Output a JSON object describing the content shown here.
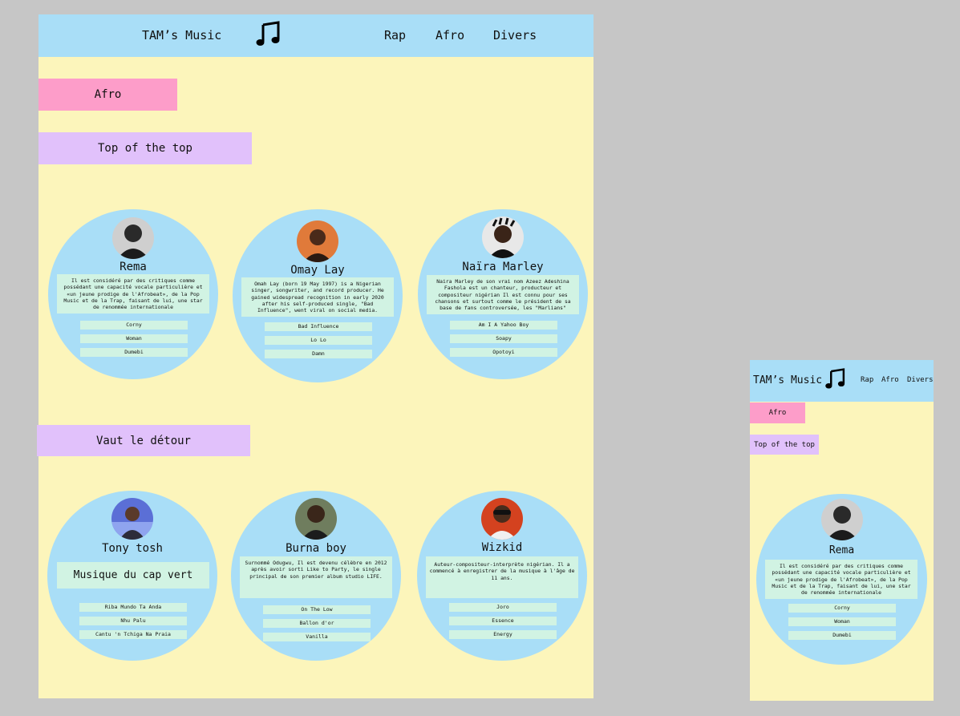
{
  "site": {
    "title": "TAM’s Music",
    "nav": [
      "Rap",
      "Afro",
      "Divers"
    ]
  },
  "page": {
    "genre": "Afro",
    "section_top": "Top of the top",
    "section_detour": "Vaut le détour"
  },
  "top_artists": [
    {
      "name": "Rema",
      "bio": "Il est considéré par des critiques comme possédant une capacité vocale particulière et «un jeune prodige de l'Afrobeat», de la Pop Music et de la Trap, faisant de lui, une star de renommée internationale",
      "songs": [
        "Corny",
        "Woman",
        "Dumebi"
      ]
    },
    {
      "name": "Omay Lay",
      "bio": "Omah Lay (born 19 May 1997) is a Nigerian singer, songwriter, and record producer. He gained widespread recognition in early 2020 after his self-produced single, \"Bad Influence\", went viral on social media.",
      "songs": [
        "Bad Influence",
        "Lo Lo",
        "Damn"
      ]
    },
    {
      "name": "Naïra Marley",
      "bio": "Naira Marley de son vrai nom Azeez Adeshina Fashola est un chanteur, producteur et compositeur nigérian Il est connu pour ses chansons et surtout comme le président de sa base de fans controversée, les \"Marlians\"",
      "songs": [
        "Am I A Yahoo Boy",
        "Soapy",
        "Opotoyi"
      ]
    }
  ],
  "detour_artists": [
    {
      "name": "Tony tosh",
      "bio": "Musique du cap vert",
      "songs": [
        "Riba Mundo Ta Anda",
        "Nhu Palu",
        "Cantu 'n Tchiga Na Praia"
      ]
    },
    {
      "name": "Burna boy",
      "bio": "Surnommé Odugwu, Il est devenu célèbre en 2012 après avoir sorti Like to Party, le single principal de son premier album studio LIFE.",
      "songs": [
        "On The Low",
        "Ballon d'or",
        "Vanilla"
      ]
    },
    {
      "name": "Wizkid",
      "bio": "Auteur-compositeur-interprète nigérian. Il a commencé à enregistrer de la musique à l'âge de 11 ans.",
      "songs": [
        "Joro",
        "Essence",
        "Energy"
      ]
    }
  ],
  "colors": {
    "background": "#c6c6c6",
    "page": "#fcf5bb",
    "nav": "#a9def7",
    "circle": "#a9def7",
    "genre_tag": "#fd9dc9",
    "section_tag": "#e1c1fb",
    "card_text_bg": "#d1f3e3"
  },
  "icons": {
    "logo": "music-note-icon",
    "avatars": "artist-photo"
  }
}
